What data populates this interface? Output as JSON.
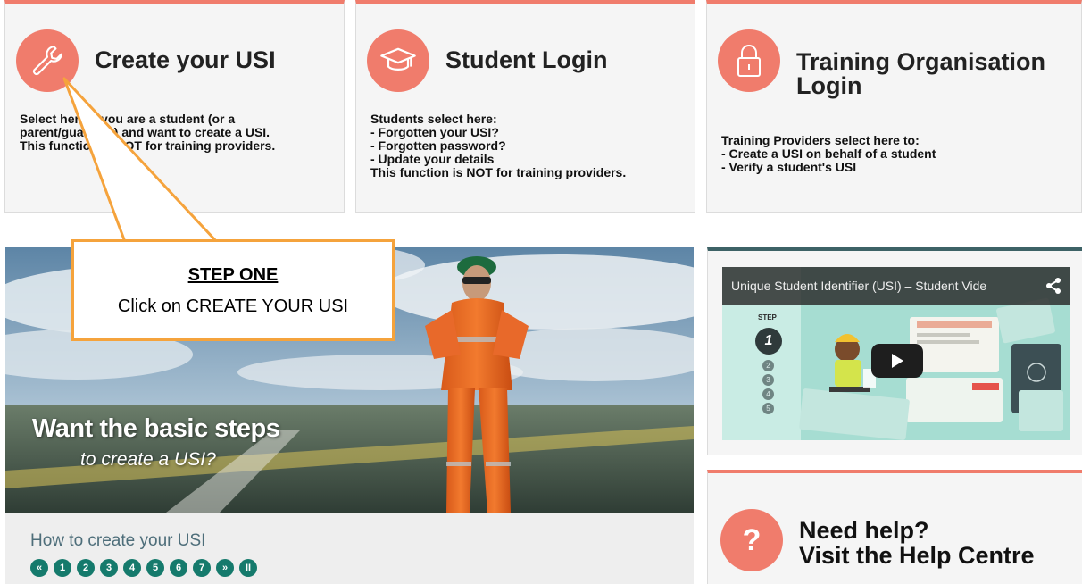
{
  "cards": [
    {
      "title": [
        "Create your USI"
      ],
      "icon": "wrench-icon",
      "desc": [
        "Select here if you are a student (or a",
        "parent/guardian) and want to create a USI.",
        "This function is NOT for training providers."
      ]
    },
    {
      "title": [
        "Student Login"
      ],
      "icon": "graduation-cap-icon",
      "desc": [
        "Students select here:",
        "- Forgotten your USI?",
        "- Forgotten password?",
        "- Update your details",
        "This function is NOT for training providers."
      ]
    },
    {
      "title": [
        "Training Organisation",
        "Login"
      ],
      "icon": "lock-icon",
      "desc": [
        "Training Providers select here to:",
        "- Create a USI on behalf of a student",
        "- Verify a student's USI"
      ]
    }
  ],
  "slideshow": {
    "headline": "Want the basic steps",
    "subheadline": "to create a USI?",
    "caption": "How to create your USI",
    "pager": [
      "«",
      "1",
      "2",
      "3",
      "4",
      "5",
      "6",
      "7",
      "»",
      "II"
    ]
  },
  "video": {
    "title": "Unique Student Identifier (USI) – Student Vide",
    "step_label": "STEP",
    "current_step": "1",
    "other_steps": [
      "2",
      "3",
      "4",
      "5"
    ]
  },
  "help": {
    "line1": "Need help?",
    "line2": "Visit the Help Centre"
  },
  "callout": {
    "title": "STEP ONE",
    "text": "Click on CREATE YOUR USI"
  },
  "colors": {
    "accent": "#f07c6c",
    "pager": "#157a6c",
    "callout_border": "#f5a33c"
  }
}
